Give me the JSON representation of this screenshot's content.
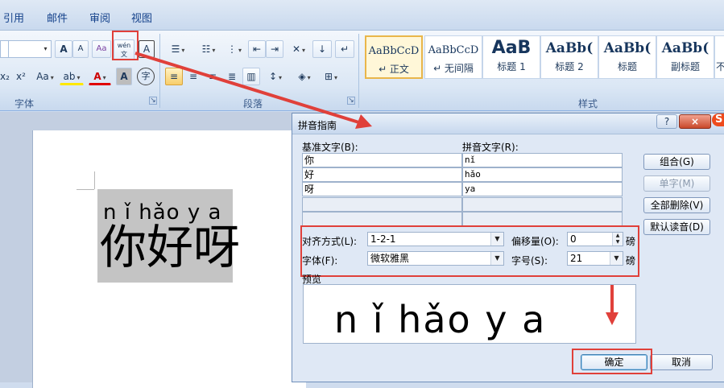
{
  "menu": [
    "引用",
    "邮件",
    "审阅",
    "视图"
  ],
  "ribbon": {
    "font_group_label": "字体",
    "paragraph_group_label": "段落",
    "styles_group_label": "样式",
    "font_buttons": {
      "grow": "A",
      "shrink": "A",
      "clear_format": "Aa",
      "phonetic_guide": "wén 文",
      "char_border": "A",
      "subscript": "x₂",
      "superscript": "x²",
      "change_case": "Aa",
      "highlight": "ab",
      "font_color": "A",
      "char_shading": "A",
      "enclose": "字"
    },
    "styles": [
      {
        "sample": "AaBbCcD",
        "name": "↵ 正文",
        "selected": true
      },
      {
        "sample": "AaBbCcD",
        "name": "↵ 无间隔",
        "selected": false
      },
      {
        "sample": "AaB",
        "name": "标题 1",
        "selected": false
      },
      {
        "sample": "AaBb(",
        "name": "标题 2",
        "selected": false
      },
      {
        "sample": "AaBb(",
        "name": "标题",
        "selected": false
      },
      {
        "sample": "AaBb(",
        "name": "副标题",
        "selected": false
      },
      {
        "sample": "",
        "name": "不",
        "selected": false
      }
    ]
  },
  "document": {
    "pinyin_line": "n ǐ hǎo y a",
    "hanzi_line": "你好呀"
  },
  "dialog": {
    "title": "拼音指南",
    "help_label": "?",
    "close_label": "×",
    "base_text_header": "基准文字(B):",
    "ruby_text_header": "拼音文字(R):",
    "rows": [
      {
        "base": "你",
        "ruby": "nǐ"
      },
      {
        "base": "好",
        "ruby": "hǎo"
      },
      {
        "base": "呀",
        "ruby": "ya"
      },
      {
        "base": "",
        "ruby": ""
      },
      {
        "base": "",
        "ruby": ""
      }
    ],
    "side_buttons": {
      "group": "组合(G)",
      "mono": "单字(M)",
      "clear_all": "全部删除(V)",
      "default_reading": "默认读音(D)"
    },
    "alignment_label": "对齐方式(L):",
    "alignment_value": "1-2-1",
    "offset_label": "偏移量(O):",
    "offset_value": "0",
    "offset_unit": "磅",
    "font_label": "字体(F):",
    "font_value": "微软雅黑",
    "size_label": "字号(S):",
    "size_value": "21",
    "size_unit": "磅",
    "preview_label": "预览",
    "preview_text": "n ǐ hǎo y a",
    "ok_label": "确定",
    "cancel_label": "取消"
  },
  "colors": {
    "annotation_red": "#e0403a",
    "ribbon_blue": "#dbe7f5"
  }
}
